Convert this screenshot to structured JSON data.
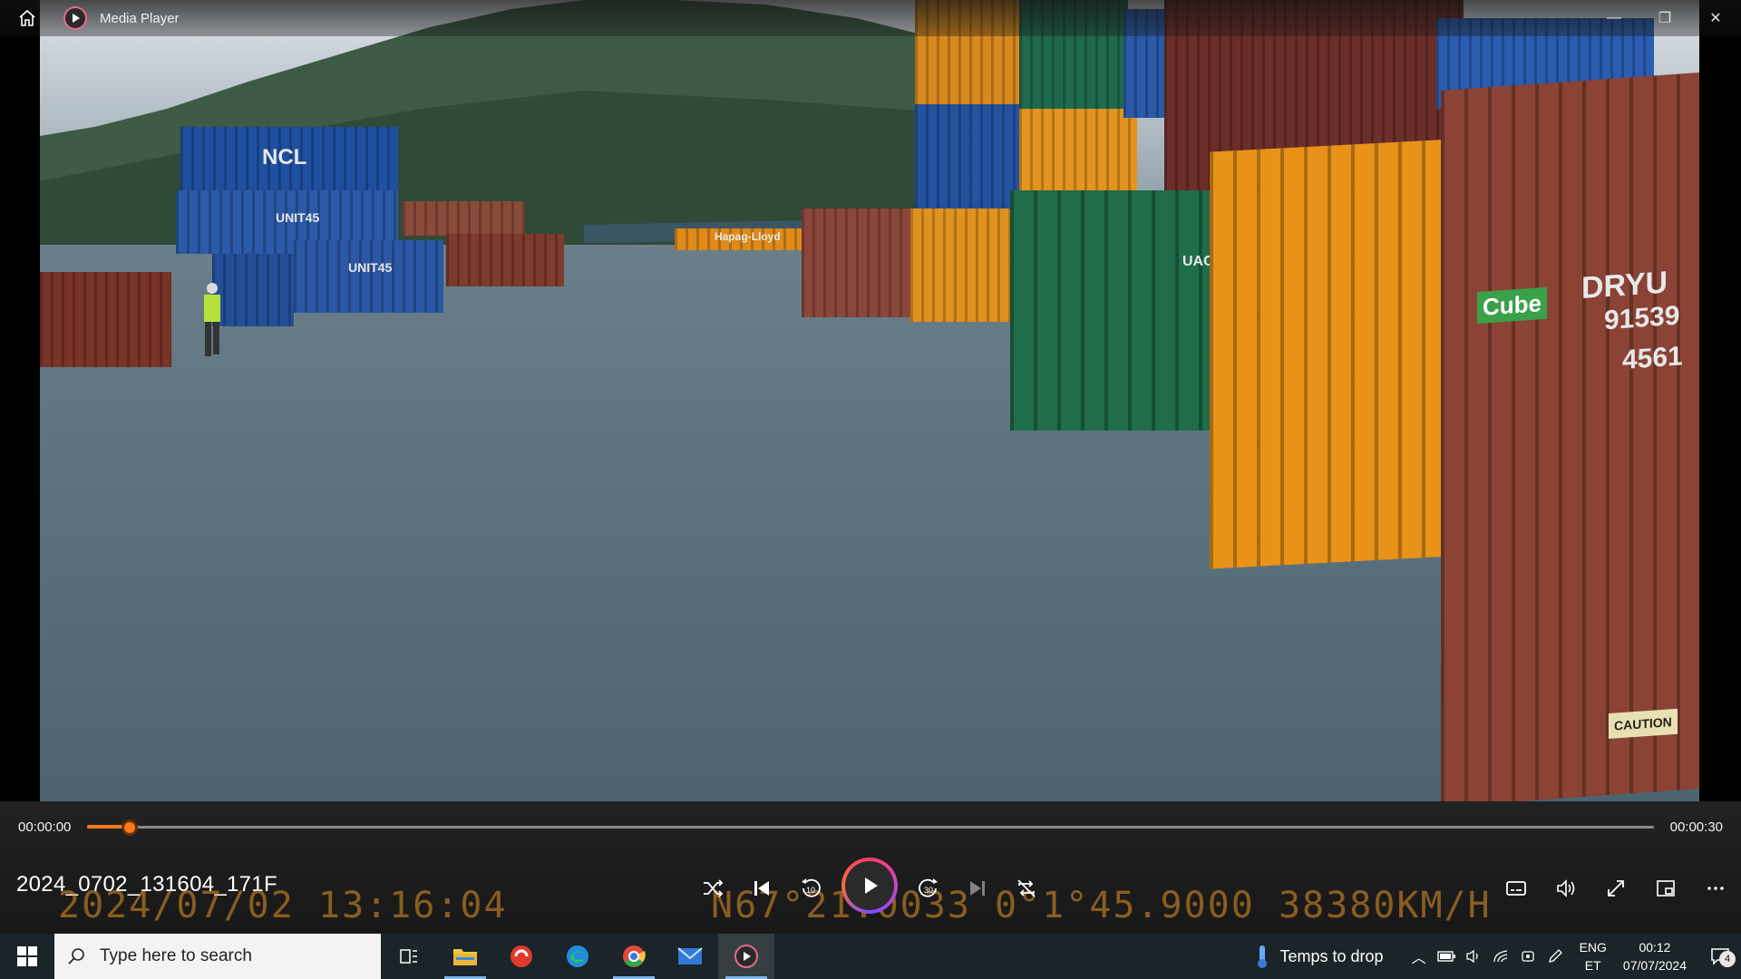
{
  "window": {
    "title": "Media Player",
    "controls": {
      "minimize": "—",
      "maximize": "❐",
      "close": "✕"
    }
  },
  "scene": {
    "container_labels": {
      "ncl": "NCL",
      "unit45_a": "UNIT45",
      "unit45_b": "UNIT45",
      "hapag": "Hapag-Lloyd",
      "uacu": "UACU",
      "cube": "Cube",
      "dryu": "DRYU",
      "num1": "91539",
      "num2": "4561",
      "caution": "CAUTION"
    }
  },
  "player": {
    "time_current": "00:00:00",
    "time_total": "00:00:30",
    "progress": 0.027,
    "filename": "2024_0702_131604_171F",
    "osd_date": "2024/07/02 13:16:04",
    "osd_coords": "N67°21.0033  0°1°45.9000  38380KM/H",
    "skip_back": "10",
    "skip_forward": "30"
  },
  "taskbar": {
    "search_placeholder": "Type here to search",
    "weather_text": "Temps to drop",
    "lang_top": "ENG",
    "lang_bottom": "ET",
    "clock_time": "00:12",
    "clock_date": "07/07/2024",
    "notification_count": "4"
  },
  "colors": {
    "accent": "#ff7a1a",
    "taskbar_bg": "#1b2428"
  }
}
